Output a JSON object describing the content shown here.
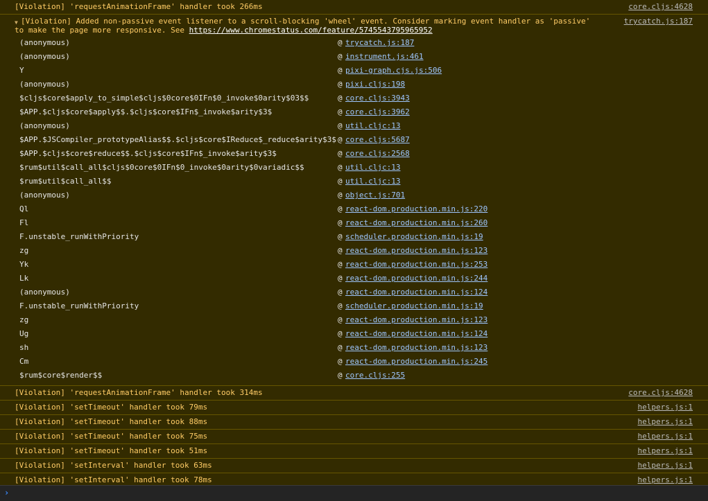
{
  "messages": [
    {
      "type": "violation",
      "text": "[Violation] 'requestAnimationFrame' handler took 266ms",
      "source": "core.cljs:4628"
    },
    {
      "type": "violation-expanded",
      "text_before_link": "[Violation] Added non-passive event listener to a scroll-blocking 'wheel' event. Consider marking event handler as 'passive' to make the page more responsive. See ",
      "link": "https://www.chromestatus.com/feature/5745543795965952",
      "source": "trycatch.js:187",
      "stack": [
        {
          "fn": "(anonymous)",
          "at": "@",
          "location": "trycatch.js:187"
        },
        {
          "fn": "(anonymous)",
          "at": "@",
          "location": "instrument.js:461"
        },
        {
          "fn": "Y",
          "at": "@",
          "location": "pixi-graph.cjs.js:506"
        },
        {
          "fn": "(anonymous)",
          "at": "@",
          "location": "pixi.cljs:198"
        },
        {
          "fn": "$cljs$core$apply_to_simple$cljs$0core$0IFn$0_invoke$0arity$03$$",
          "at": "@",
          "location": "core.cljs:3943"
        },
        {
          "fn": "$APP.$cljs$core$apply$$.$cljs$core$IFn$_invoke$arity$3$",
          "at": "@",
          "location": "core.cljs:3962"
        },
        {
          "fn": "(anonymous)",
          "at": "@",
          "location": "util.cljc:13"
        },
        {
          "fn": "$APP.$JSCompiler_prototypeAlias$$.$cljs$core$IReduce$_reduce$arity$3$",
          "at": "@",
          "location": "core.cljs:5687"
        },
        {
          "fn": "$APP.$cljs$core$reduce$$.$cljs$core$IFn$_invoke$arity$3$",
          "at": "@",
          "location": "core.cljs:2568"
        },
        {
          "fn": "$rum$util$call_all$cljs$0core$0IFn$0_invoke$0arity$0variadic$$",
          "at": "@",
          "location": "util.cljc:13"
        },
        {
          "fn": "$rum$util$call_all$$",
          "at": "@",
          "location": "util.cljc:13"
        },
        {
          "fn": "(anonymous)",
          "at": "@",
          "location": "object.js:701"
        },
        {
          "fn": "Ql",
          "at": "@",
          "location": "react-dom.production.min.js:220"
        },
        {
          "fn": "Fl",
          "at": "@",
          "location": "react-dom.production.min.js:260"
        },
        {
          "fn": "F.unstable_runWithPriority",
          "at": "@",
          "location": "scheduler.production.min.js:19"
        },
        {
          "fn": "zg",
          "at": "@",
          "location": "react-dom.production.min.js:123"
        },
        {
          "fn": "Yk",
          "at": "@",
          "location": "react-dom.production.min.js:253"
        },
        {
          "fn": "Lk",
          "at": "@",
          "location": "react-dom.production.min.js:244"
        },
        {
          "fn": "(anonymous)",
          "at": "@",
          "location": "react-dom.production.min.js:124"
        },
        {
          "fn": "F.unstable_runWithPriority",
          "at": "@",
          "location": "scheduler.production.min.js:19"
        },
        {
          "fn": "zg",
          "at": "@",
          "location": "react-dom.production.min.js:123"
        },
        {
          "fn": "Ug",
          "at": "@",
          "location": "react-dom.production.min.js:124"
        },
        {
          "fn": "sh",
          "at": "@",
          "location": "react-dom.production.min.js:123"
        },
        {
          "fn": "Cm",
          "at": "@",
          "location": "react-dom.production.min.js:245"
        },
        {
          "fn": "$rum$core$render$$",
          "at": "@",
          "location": "core.cljs:255"
        }
      ]
    },
    {
      "type": "violation",
      "text": "[Violation] 'requestAnimationFrame' handler took 314ms",
      "source": "core.cljs:4628"
    },
    {
      "type": "violation",
      "text": "[Violation] 'setTimeout' handler took 79ms",
      "source": "helpers.js:1"
    },
    {
      "type": "violation",
      "text": "[Violation] 'setTimeout' handler took 88ms",
      "source": "helpers.js:1"
    },
    {
      "type": "violation",
      "text": "[Violation] 'setTimeout' handler took 75ms",
      "source": "helpers.js:1"
    },
    {
      "type": "violation",
      "text": "[Violation] 'setTimeout' handler took 51ms",
      "source": "helpers.js:1"
    },
    {
      "type": "violation",
      "text": "[Violation] 'setInterval' handler took 63ms",
      "source": "helpers.js:1"
    },
    {
      "type": "violation",
      "text": "[Violation] 'setInterval' handler took 78ms",
      "source": "helpers.js:1"
    }
  ],
  "prompt": {
    "caret_icon": "chevron-right-icon",
    "caret_glyph": "›"
  },
  "colors": {
    "background": "#332b00",
    "warning_text": "#ffcc66",
    "border": "#665500",
    "stack_link": "#9ec6ff",
    "source_link": "#bbbbbb",
    "prompt_background": "#242424",
    "prompt_caret": "#3b8cff"
  }
}
